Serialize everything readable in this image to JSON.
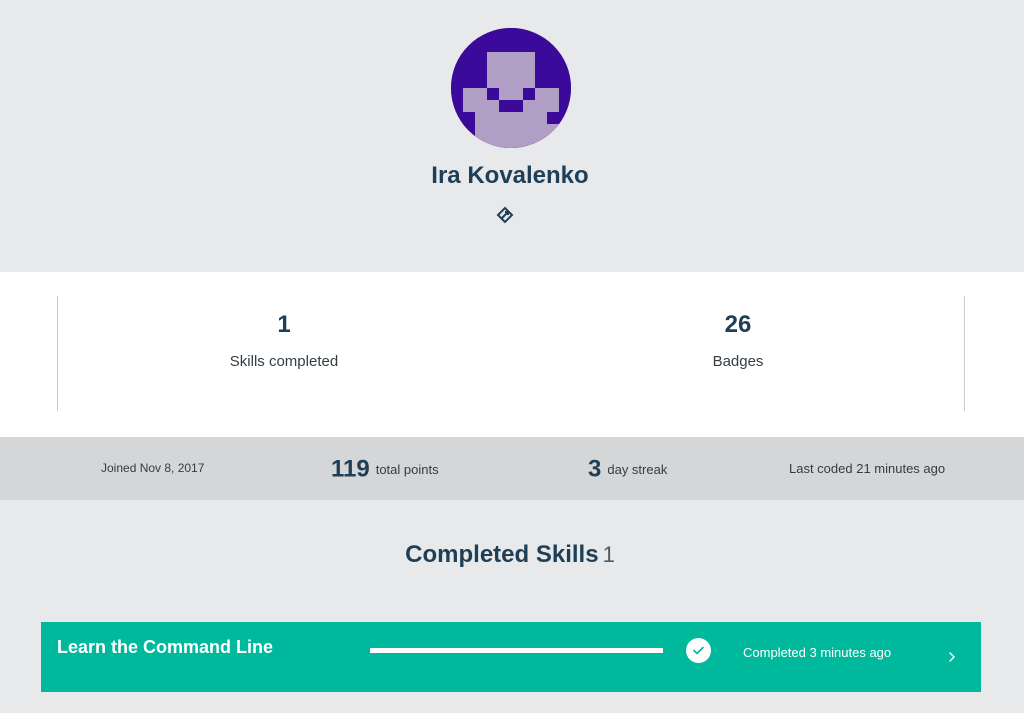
{
  "profile": {
    "name": "Ira Kovalenko",
    "avatar_color": "#3b0a9b",
    "avatar_icon": "pixel-avatar-icon",
    "link_icon": "link-icon"
  },
  "stats": {
    "skills_completed": {
      "value": "1",
      "label": "Skills completed"
    },
    "badges": {
      "value": "26",
      "label": "Badges"
    }
  },
  "meta": {
    "joined": "Joined Nov 8, 2017",
    "points": {
      "value": "119",
      "label": "total points"
    },
    "streak": {
      "value": "3",
      "label": "day streak"
    },
    "last_coded": "Last coded 21 minutes ago"
  },
  "completed_skills": {
    "title": "Completed Skills",
    "count": "1",
    "items": [
      {
        "name": "Learn the Command Line",
        "progress": 1.0,
        "status_icon": "check-icon",
        "completed_text": "Completed 3 minutes ago",
        "chevron_icon": "chevron-right-icon",
        "color": "#00b89c"
      }
    ]
  },
  "colors": {
    "text_primary": "#1f3f56",
    "page_background": "#e8e9ea",
    "meta_bar": "#d4d6d8",
    "accent": "#00b89c"
  }
}
